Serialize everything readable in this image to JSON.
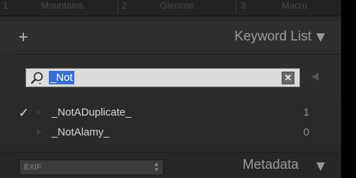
{
  "top_strip": {
    "cells": [
      {
        "num": "1",
        "label": "Mountains"
      },
      {
        "num": "2",
        "label": "Glencoe"
      },
      {
        "num": "3",
        "label": "Macro"
      }
    ]
  },
  "keyword_list": {
    "add_icon": "plus-icon",
    "title": "Keyword List",
    "collapse_icon": "triangle-down-icon"
  },
  "filter": {
    "search_value": "_Not",
    "search_icon": "magnifier-icon",
    "clear_icon": "clear-x-icon"
  },
  "keywords": [
    {
      "checked": true,
      "label": "_NotADuplicate_",
      "count": "1"
    },
    {
      "checked": false,
      "label": "_NotAlamy_",
      "count": "0"
    }
  ],
  "metadata": {
    "preset_value": "EXIF",
    "title": "Metadata",
    "collapse_icon": "triangle-down-icon"
  },
  "colors": {
    "panel_bg": "#2a2a2a",
    "selection": "#3a6ed0",
    "text": "#d6d6d6",
    "header_text": "#9c9c9c"
  }
}
